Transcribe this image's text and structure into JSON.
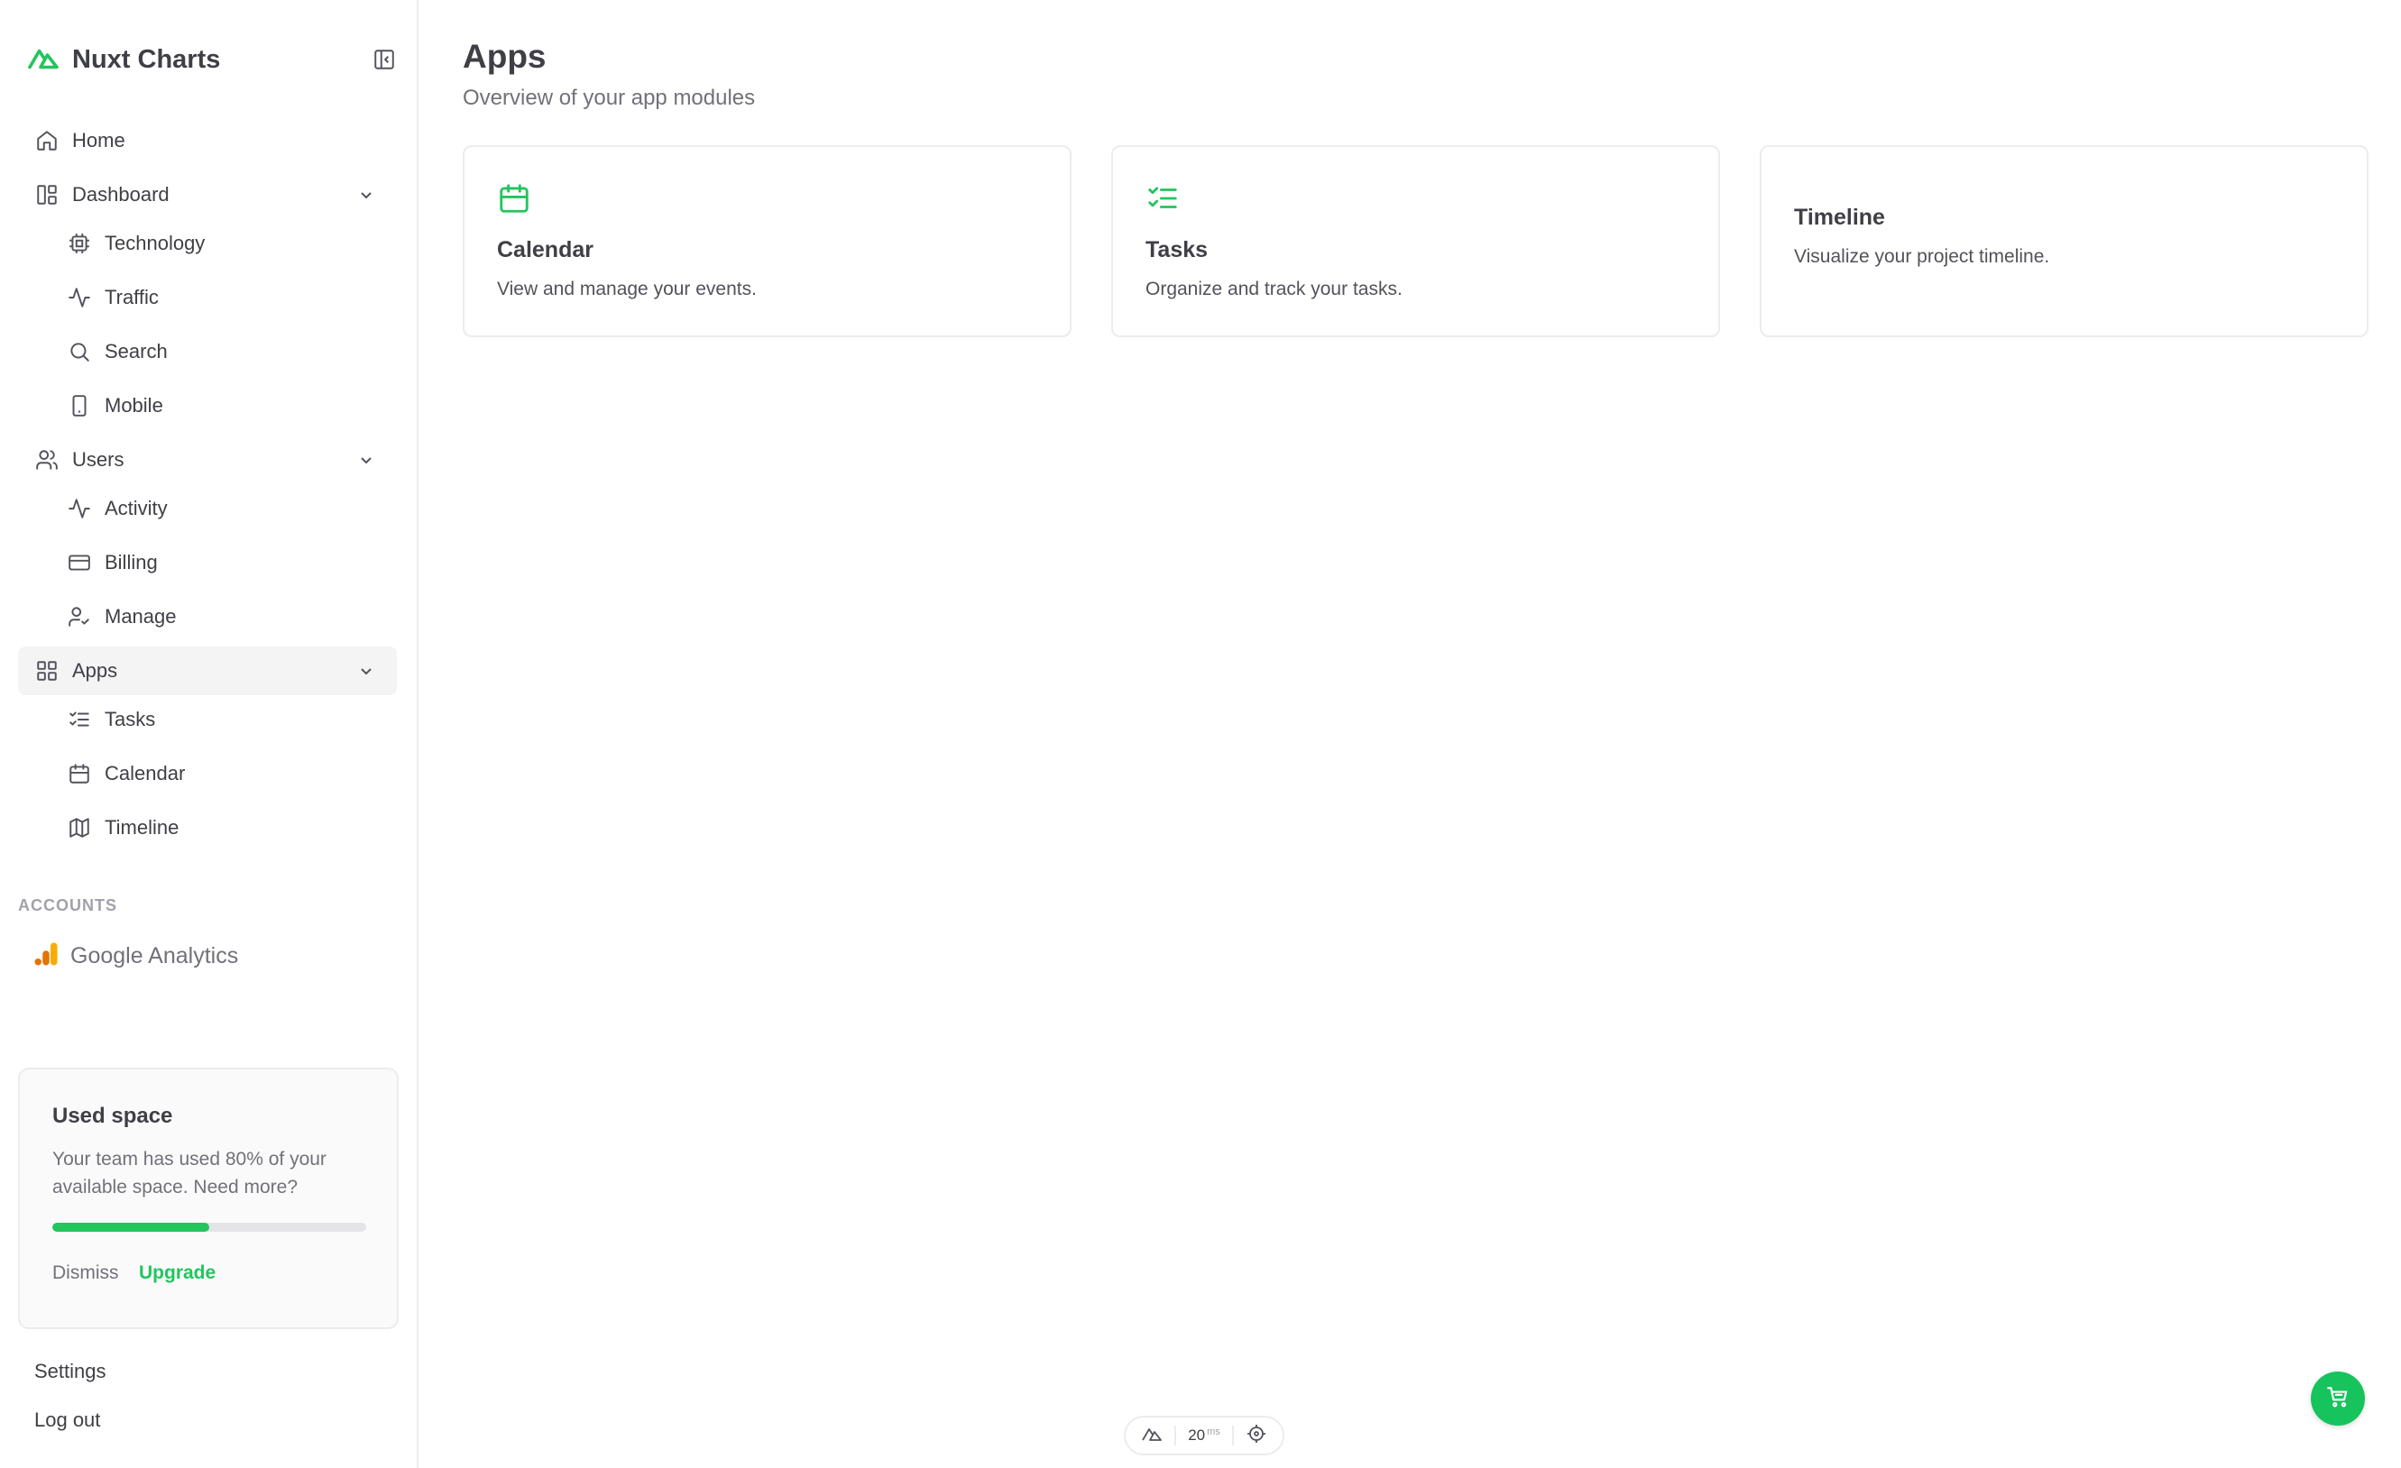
{
  "app": {
    "name": "Nuxt Charts"
  },
  "sidebar": {
    "items": [
      {
        "label": "Home",
        "icon": "home-icon"
      },
      {
        "label": "Dashboard",
        "icon": "dashboard-icon",
        "expanded": true,
        "children": [
          {
            "label": "Technology",
            "icon": "cpu-icon"
          },
          {
            "label": "Traffic",
            "icon": "activity-icon"
          },
          {
            "label": "Search",
            "icon": "search-icon"
          },
          {
            "label": "Mobile",
            "icon": "smartphone-icon"
          }
        ]
      },
      {
        "label": "Users",
        "icon": "users-icon",
        "expanded": true,
        "children": [
          {
            "label": "Activity",
            "icon": "activity-icon"
          },
          {
            "label": "Billing",
            "icon": "credit-card-icon"
          },
          {
            "label": "Manage",
            "icon": "user-check-icon"
          }
        ]
      },
      {
        "label": "Apps",
        "icon": "grid-icon",
        "expanded": true,
        "active": true,
        "children": [
          {
            "label": "Tasks",
            "icon": "list-checks-icon"
          },
          {
            "label": "Calendar",
            "icon": "calendar-icon"
          },
          {
            "label": "Timeline",
            "icon": "map-icon"
          }
        ]
      }
    ],
    "accounts_label": "ACCOUNTS",
    "accounts": [
      {
        "label": "Google Analytics",
        "icon": "google-analytics-icon"
      }
    ],
    "usage": {
      "title": "Used space",
      "description": "Your team has used 80% of your available space. Need more?",
      "progress": 0.5,
      "dismiss": "Dismiss",
      "upgrade": "Upgrade"
    },
    "footer": {
      "settings": "Settings",
      "logout": "Log out"
    }
  },
  "main": {
    "title": "Apps",
    "subtitle": "Overview of your app modules",
    "cards": [
      {
        "title": "Calendar",
        "description": "View and manage your events.",
        "icon": "calendar-icon"
      },
      {
        "title": "Tasks",
        "description": "Organize and track your tasks.",
        "icon": "list-checks-icon"
      },
      {
        "title": "Timeline",
        "description": "Visualize your project timeline."
      }
    ]
  },
  "devtools": {
    "value": "20",
    "unit": "ms"
  },
  "colors": {
    "accent": "#22c55e",
    "text": "#3f3f46",
    "muted": "#71717a",
    "border": "#ececee"
  }
}
